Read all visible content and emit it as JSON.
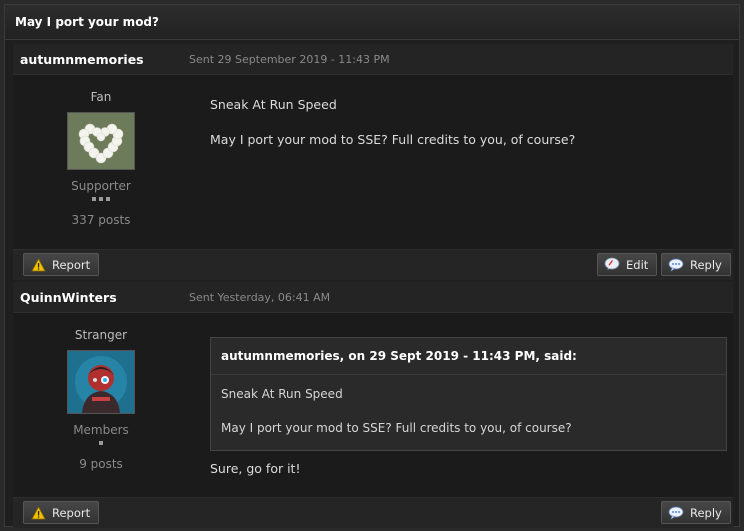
{
  "page": {
    "title": "May I port your mod?"
  },
  "posts": [
    {
      "author": "autumnmemories",
      "date": "Sent 29 September 2019 - 11:43 PM",
      "rank": "Fan",
      "group": "Supporter",
      "posts_count": "337 posts",
      "body": [
        "Sneak At Run Speed",
        "May I port your mod to SSE? Full credits to you, of course?"
      ],
      "buttons": {
        "report": "Report",
        "edit": "Edit",
        "reply": "Reply"
      },
      "avatar_icon": "heart-wreath-avatar"
    },
    {
      "author": "QuinnWinters",
      "date": "Sent Yesterday, 06:41 AM",
      "rank": "Stranger",
      "group": "Members",
      "posts_count": "9 posts",
      "quote": {
        "header": "autumnmemories, on 29 Sept 2019 - 11:43 PM, said:",
        "lines": [
          "Sneak At Run Speed",
          "May I port your mod to SSE? Full credits to you, of course?"
        ]
      },
      "reply_text": "Sure, go for it!",
      "buttons": {
        "report": "Report",
        "reply": "Reply"
      },
      "avatar_icon": "character-avatar"
    }
  ],
  "colors": {
    "warning": "#f2c200",
    "accent": "#2f6fd0"
  }
}
